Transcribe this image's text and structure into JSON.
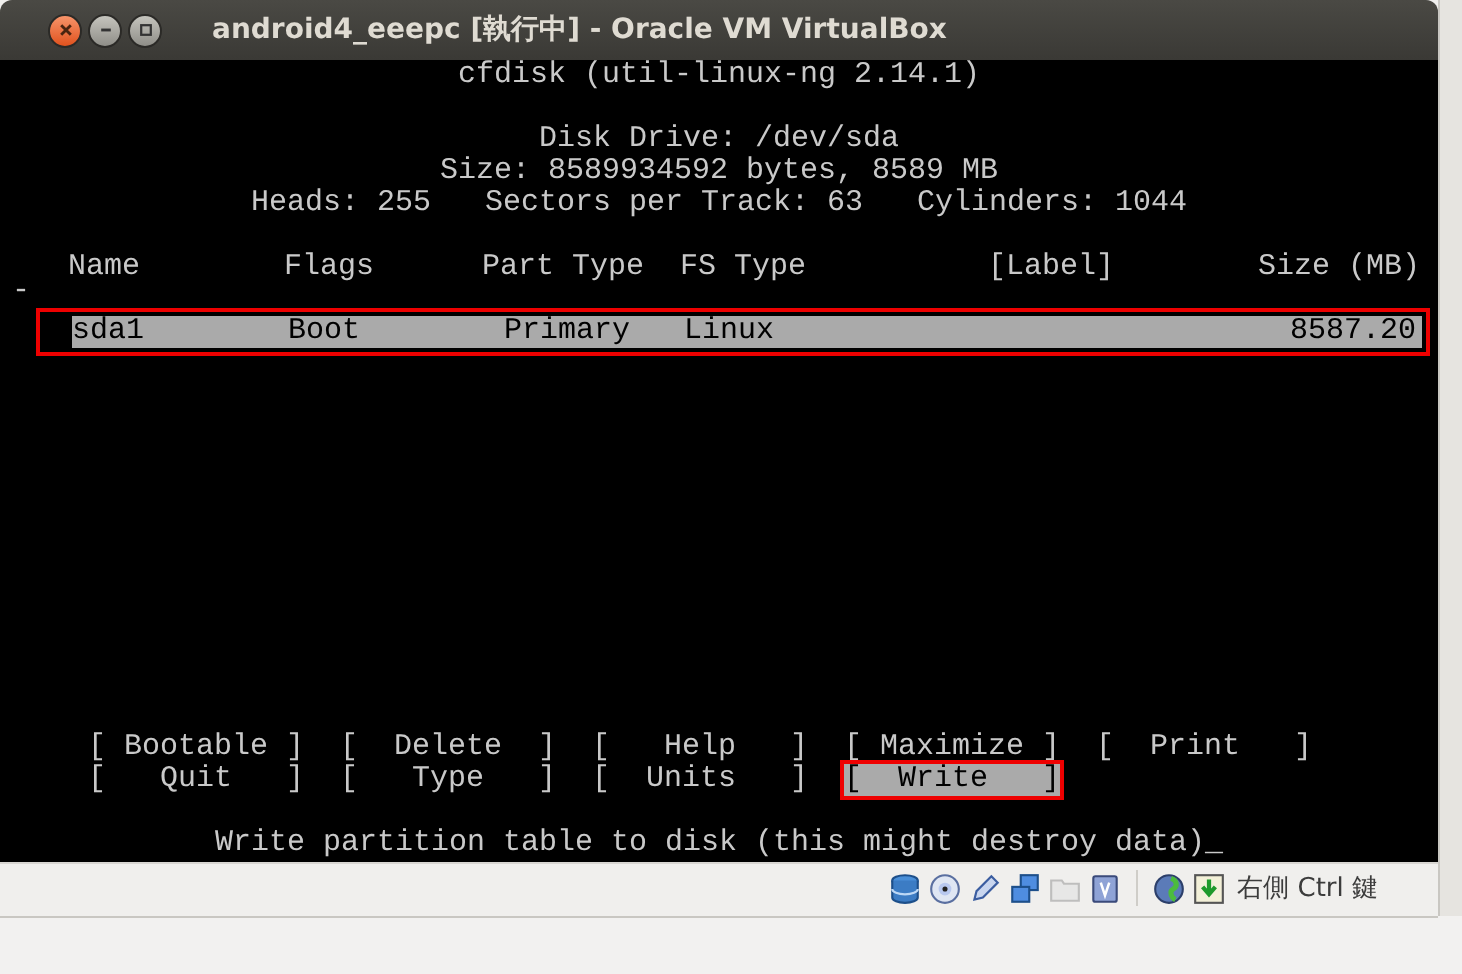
{
  "window": {
    "title": "android4_eeepc [執行中] - Oracle VM VirtualBox"
  },
  "terminal": {
    "program_line": "cfdisk (util-linux-ng 2.14.1)",
    "disk_info": [
      "Disk Drive: /dev/sda",
      "Size: 8589934592 bytes, 8589 MB",
      "Heads: 255   Sectors per Track: 63   Cylinders: 1044"
    ],
    "table": {
      "columns": [
        "Name",
        "Flags",
        "Part Type",
        "FS Type",
        "[Label]",
        "Size (MB)"
      ],
      "marker": "-",
      "rows": [
        {
          "cells": [
            "sda1",
            "Boot",
            "Primary",
            "Linux",
            "",
            "8587.20"
          ],
          "selected": true,
          "annotated": true
        }
      ]
    },
    "menu": [
      {
        "label": "[ Bootable ]",
        "selected": false,
        "annotated": false
      },
      {
        "label": "[  Delete  ]",
        "selected": false,
        "annotated": false
      },
      {
        "label": "[   Help   ]",
        "selected": false,
        "annotated": false
      },
      {
        "label": "[ Maximize ]",
        "selected": false,
        "annotated": false
      },
      {
        "label": "[  Print   ]",
        "selected": false,
        "annotated": false
      },
      {
        "label": "[   Quit   ]",
        "selected": false,
        "annotated": false
      },
      {
        "label": "[   Type   ]",
        "selected": false,
        "annotated": false
      },
      {
        "label": "[  Units   ]",
        "selected": false,
        "annotated": false
      },
      {
        "label": "[  Write   ]",
        "selected": true,
        "annotated": true
      }
    ],
    "message": "Write partition table to disk (this might destroy data)_"
  },
  "status_bar": {
    "host_key": "右側 Ctrl 鍵"
  }
}
